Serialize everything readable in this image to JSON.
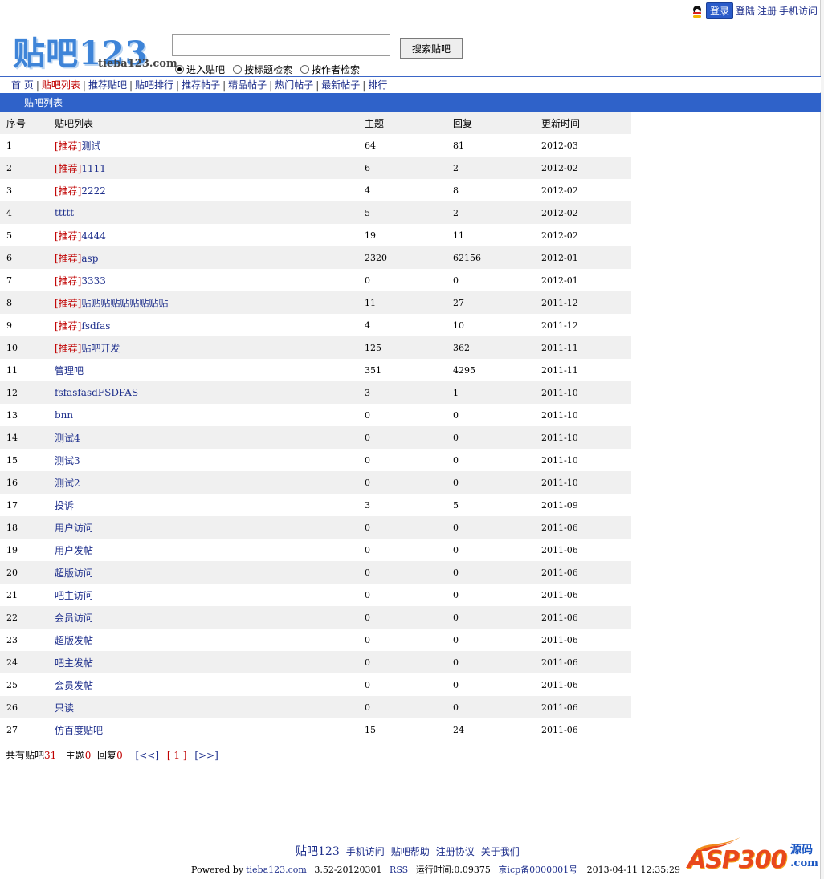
{
  "top_links": {
    "qq_login": "登录",
    "login": "登陆",
    "register": "注册",
    "mobile": "手机访问"
  },
  "logo": {
    "text": "贴吧123",
    "domain": "tieba123.com"
  },
  "search": {
    "input_value": "",
    "button": "搜索贴吧",
    "options": [
      "进入贴吧",
      "按标题检索",
      "按作者检索"
    ],
    "selected_index": 0
  },
  "nav": {
    "items": [
      "首 页",
      "贴吧列表",
      "推荐贴吧",
      "贴吧排行",
      "推荐帖子",
      "精品帖子",
      "热门帖子",
      "最新帖子",
      "排行"
    ],
    "active_index": 1
  },
  "section_title": "贴吧列表",
  "table": {
    "headers": [
      "序号",
      "贴吧列表",
      "主题",
      "回复",
      "更新时间"
    ],
    "recommend_tag": "[推荐]",
    "rows": [
      {
        "idx": "1",
        "rec": true,
        "name": "测试",
        "topics": "64",
        "replies": "81",
        "time": "2012-03"
      },
      {
        "idx": "2",
        "rec": true,
        "name": "1111",
        "topics": "6",
        "replies": "2",
        "time": "2012-02"
      },
      {
        "idx": "3",
        "rec": true,
        "name": "2222",
        "topics": "4",
        "replies": "8",
        "time": "2012-02"
      },
      {
        "idx": "4",
        "rec": false,
        "name": "ttttt",
        "topics": "5",
        "replies": "2",
        "time": "2012-02"
      },
      {
        "idx": "5",
        "rec": true,
        "name": "4444",
        "topics": "19",
        "replies": "11",
        "time": "2012-02"
      },
      {
        "idx": "6",
        "rec": true,
        "name": "asp",
        "topics": "2320",
        "replies": "62156",
        "time": "2012-01"
      },
      {
        "idx": "7",
        "rec": true,
        "name": "3333",
        "topics": "0",
        "replies": "0",
        "time": "2012-01"
      },
      {
        "idx": "8",
        "rec": true,
        "name": "贴贴贴贴贴贴贴贴贴",
        "topics": "11",
        "replies": "27",
        "time": "2011-12"
      },
      {
        "idx": "9",
        "rec": true,
        "name": "fsdfas",
        "topics": "4",
        "replies": "10",
        "time": "2011-12"
      },
      {
        "idx": "10",
        "rec": true,
        "name": "贴吧开发",
        "topics": "125",
        "replies": "362",
        "time": "2011-11"
      },
      {
        "idx": "11",
        "rec": false,
        "name": "管理吧",
        "topics": "351",
        "replies": "4295",
        "time": "2011-11"
      },
      {
        "idx": "12",
        "rec": false,
        "name": "fsfasfasdFSDFAS",
        "topics": "3",
        "replies": "1",
        "time": "2011-10"
      },
      {
        "idx": "13",
        "rec": false,
        "name": "bnn",
        "topics": "0",
        "replies": "0",
        "time": "2011-10"
      },
      {
        "idx": "14",
        "rec": false,
        "name": "测试4",
        "topics": "0",
        "replies": "0",
        "time": "2011-10"
      },
      {
        "idx": "15",
        "rec": false,
        "name": "测试3",
        "topics": "0",
        "replies": "0",
        "time": "2011-10"
      },
      {
        "idx": "16",
        "rec": false,
        "name": "测试2",
        "topics": "0",
        "replies": "0",
        "time": "2011-10"
      },
      {
        "idx": "17",
        "rec": false,
        "name": "投诉",
        "topics": "3",
        "replies": "5",
        "time": "2011-09"
      },
      {
        "idx": "18",
        "rec": false,
        "name": "用户访问",
        "topics": "0",
        "replies": "0",
        "time": "2011-06"
      },
      {
        "idx": "19",
        "rec": false,
        "name": "用户发帖",
        "topics": "0",
        "replies": "0",
        "time": "2011-06"
      },
      {
        "idx": "20",
        "rec": false,
        "name": "超版访问",
        "topics": "0",
        "replies": "0",
        "time": "2011-06"
      },
      {
        "idx": "21",
        "rec": false,
        "name": "吧主访问",
        "topics": "0",
        "replies": "0",
        "time": "2011-06"
      },
      {
        "idx": "22",
        "rec": false,
        "name": "会员访问",
        "topics": "0",
        "replies": "0",
        "time": "2011-06"
      },
      {
        "idx": "23",
        "rec": false,
        "name": "超版发帖",
        "topics": "0",
        "replies": "0",
        "time": "2011-06"
      },
      {
        "idx": "24",
        "rec": false,
        "name": "吧主发帖",
        "topics": "0",
        "replies": "0",
        "time": "2011-06"
      },
      {
        "idx": "25",
        "rec": false,
        "name": "会员发帖",
        "topics": "0",
        "replies": "0",
        "time": "2011-06"
      },
      {
        "idx": "26",
        "rec": false,
        "name": "只读",
        "topics": "0",
        "replies": "0",
        "time": "2011-06"
      },
      {
        "idx": "27",
        "rec": false,
        "name": "仿百度贴吧",
        "topics": "15",
        "replies": "24",
        "time": "2011-06"
      }
    ]
  },
  "summary": {
    "total_label": "共有贴吧",
    "total": "31",
    "topics_label": "主题",
    "topics": "0",
    "replies_label": "回复",
    "replies": "0",
    "prev": "[<<]",
    "page": "[ 1 ]",
    "next": "[>>]"
  },
  "footer": {
    "brand": "贴吧123",
    "links": [
      "手机访问",
      "贴吧帮助",
      "注册协议",
      "关于我们"
    ],
    "powered_by": "Powered by",
    "site": "tieba123.com",
    "version": "3.52-20120301",
    "rss": "RSS",
    "runtime": "运行时间:0.09375",
    "icp": "京icp备0000001号",
    "datetime": "2013-04-11 12:35:29"
  },
  "watermark": {
    "text": "ASP300",
    "sub": "源码",
    "sub2": ".com"
  },
  "colors": {
    "link": "#1e2f8c",
    "recommend": "#c00000",
    "header_bar": "#2f62c9",
    "row_alt": "#f0f0f0"
  }
}
